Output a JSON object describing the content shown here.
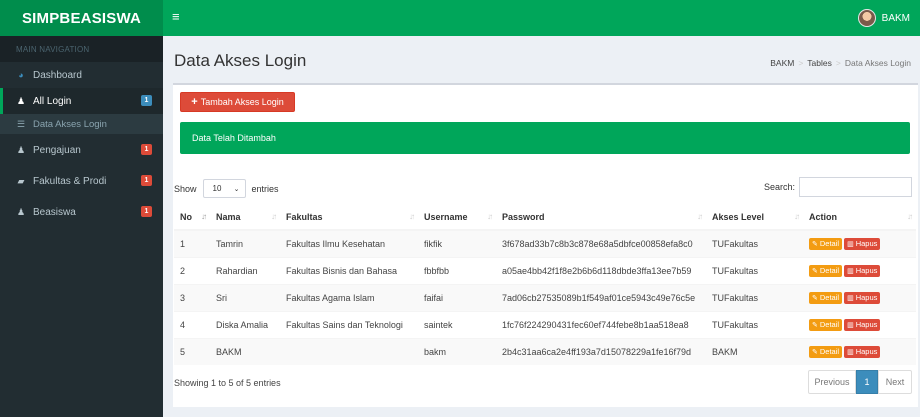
{
  "brand": "SIMPBEASISWA",
  "header": {
    "menu_icon": "hamburger-icon",
    "user_name": "BAKM"
  },
  "sidebar": {
    "heading": "MAIN NAVIGATION",
    "items": [
      {
        "label": "Dashboard",
        "icon": "dashboard-icon",
        "badge": ""
      },
      {
        "label": "All Login",
        "icon": "user-icon",
        "badge": "1"
      },
      {
        "label": "Pengajuan",
        "icon": "user-icon",
        "badge": "1"
      },
      {
        "label": "Fakultas & Prodi",
        "icon": "book-icon",
        "badge": "1"
      },
      {
        "label": "Beasiswa",
        "icon": "user-icon",
        "badge": "1"
      }
    ],
    "submenu": [
      {
        "label": "Data Akses Login",
        "icon": "table-icon"
      }
    ]
  },
  "page": {
    "title": "Data Akses Login",
    "breadcrumb": [
      "BAKM",
      "Tables",
      "Data Akses Login"
    ]
  },
  "box": {
    "add_button": "Tambah Akses Login",
    "alert": "Data Telah Ditambah",
    "show_label": "Show",
    "entries_value": "10",
    "entries_label": "entries",
    "search_label": "Search:",
    "search_value": ""
  },
  "table": {
    "columns": [
      "No",
      "Nama",
      "Fakultas",
      "Username",
      "Password",
      "Akses Level",
      "Action"
    ],
    "rows": [
      {
        "no": "1",
        "nama": "Tamrin",
        "fakultas": "Fakultas Ilmu Kesehatan",
        "username": "fikfik",
        "password": "3f678ad33b7c8b3c878e68a5dbfce00858efa8c0",
        "level": "TUFakultas"
      },
      {
        "no": "2",
        "nama": "Rahardian",
        "fakultas": "Fakultas Bisnis dan Bahasa",
        "username": "fbbfbb",
        "password": "a05ae4bb42f1f8e2b6b6d118dbde3ffa13ee7b59",
        "level": "TUFakultas"
      },
      {
        "no": "3",
        "nama": "Sri",
        "fakultas": "Fakultas Agama Islam",
        "username": "faifai",
        "password": "7ad06cb27535089b1f549af01ce5943c49e76c5e",
        "level": "TUFakultas"
      },
      {
        "no": "4",
        "nama": "Diska Amalia",
        "fakultas": "Fakultas Sains dan Teknologi",
        "username": "saintek",
        "password": "1fc76f224290431fec60ef744febe8b1aa518ea8",
        "level": "TUFakultas"
      },
      {
        "no": "5",
        "nama": "BAKM",
        "fakultas": "",
        "username": "bakm",
        "password": "2b4c31aa6ca2e4ff193a7d15078229a1fe16f79d",
        "level": "BAKM"
      }
    ],
    "detail_label": "Detail",
    "hapus_label": "Hapus"
  },
  "footer": {
    "info": "Showing 1 to 5 of 5 entries",
    "previous": "Previous",
    "page": "1",
    "next": "Next"
  }
}
